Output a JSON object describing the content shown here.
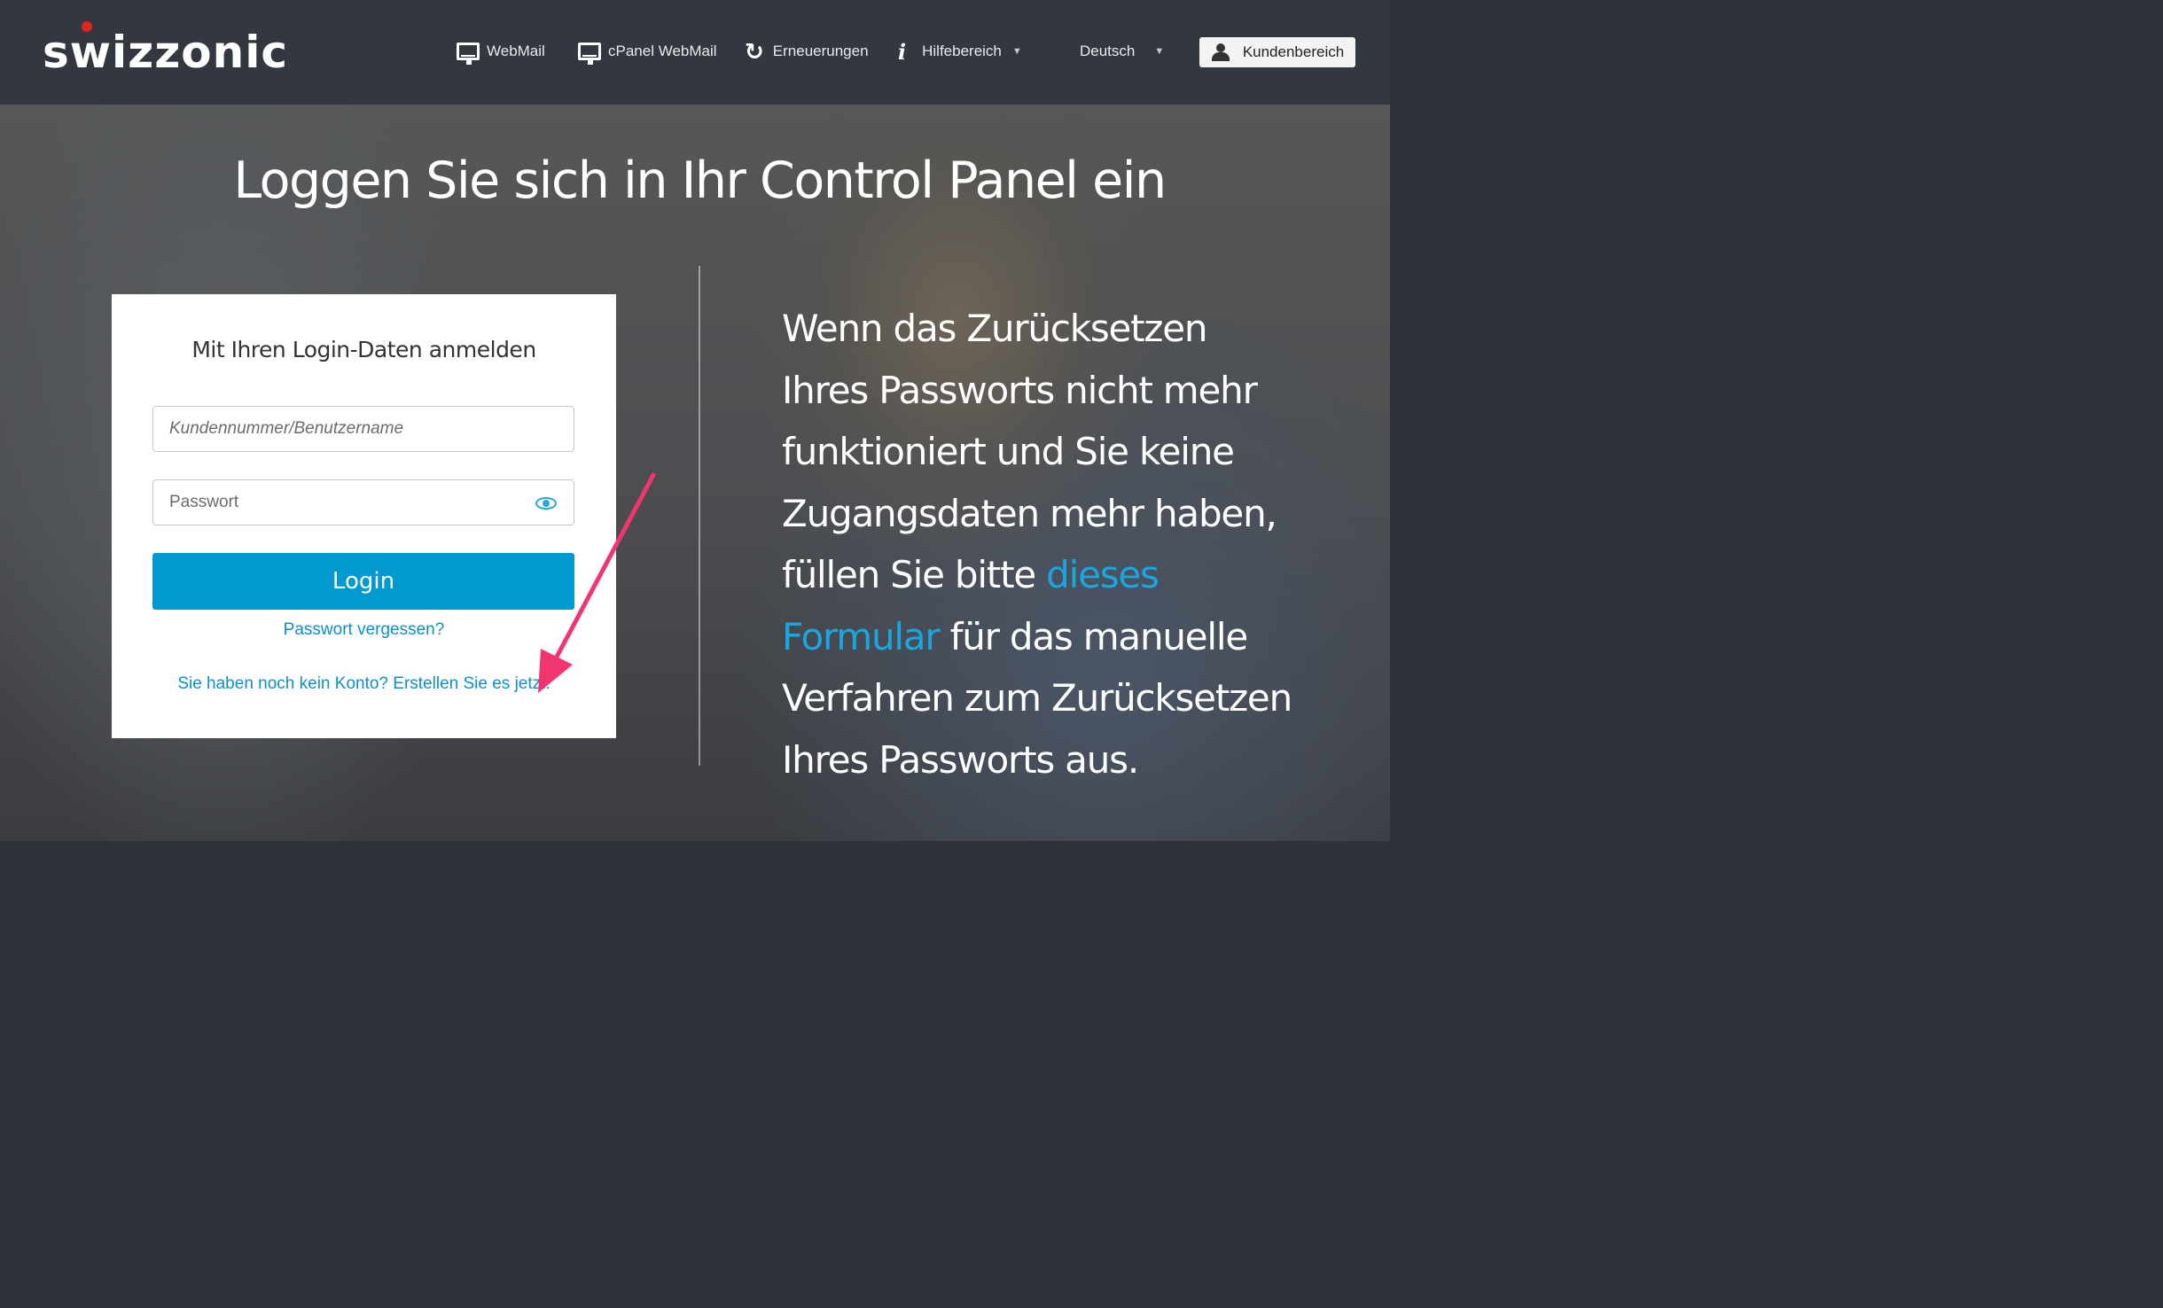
{
  "header": {
    "logo_text": "swizzonic",
    "nav": [
      {
        "label": "WebMail",
        "icon": "monitor-icon"
      },
      {
        "label": "cPanel WebMail",
        "icon": "monitor-icon"
      },
      {
        "label": "Erneuerungen",
        "icon": "refresh-icon"
      },
      {
        "label": "Hilfebereich",
        "icon": "info-icon"
      }
    ],
    "language": "Deutsch",
    "account_button": "Kundenbereich"
  },
  "hero": {
    "title": "Loggen Sie sich in Ihr Control Panel ein"
  },
  "login": {
    "title": "Mit Ihren Login-Daten anmelden",
    "username_placeholder": "Kundennummer/Benutzername",
    "password_placeholder": "Passwort",
    "submit_label": "Login",
    "forgot_link": "Passwort vergessen?",
    "create_link": "Sie haben noch kein Konto? Erstellen Sie es jetzt."
  },
  "info": {
    "text_before": "Wenn das Zurücksetzen Ihres Passworts nicht mehr funktioniert und Sie keine Zugangsdaten mehr haben, füllen Sie bitte ",
    "link_text": "dieses Formular",
    "text_after": " für das manuelle Verfahren zum Zurücksetzen Ihres Passworts aus."
  },
  "colors": {
    "accent": "#0199d0",
    "link": "#0b8fd0",
    "annotation_arrow": "#f0356f",
    "topbar": "#33373f"
  }
}
